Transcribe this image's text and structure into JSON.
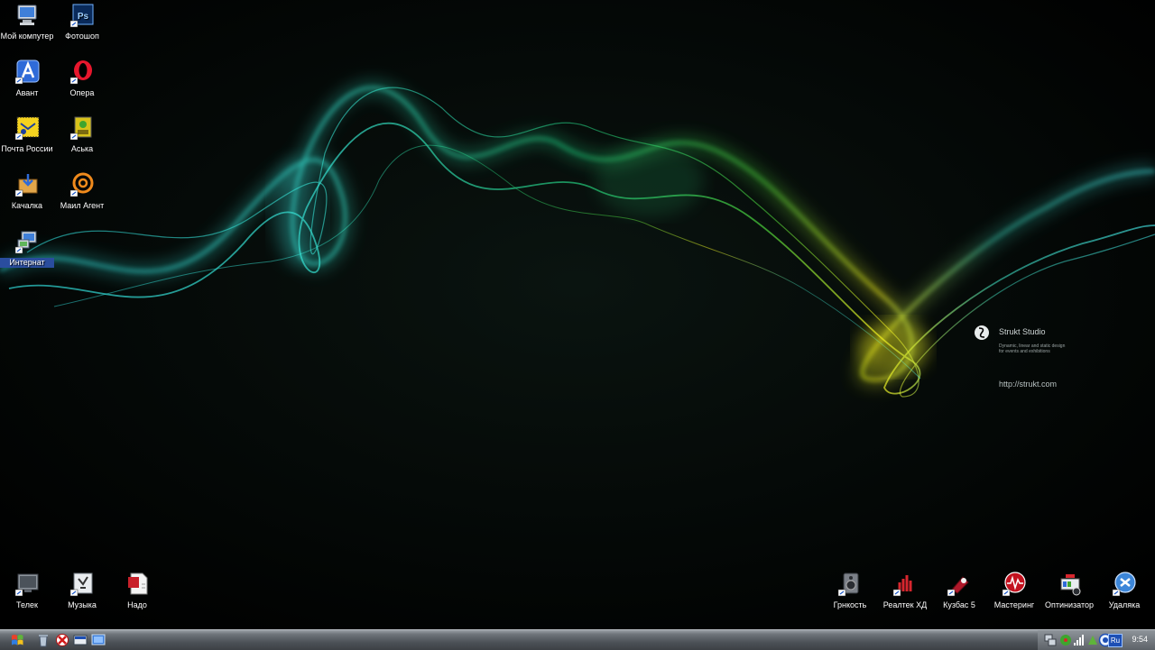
{
  "desktop": {
    "icons_left": [
      {
        "label": "Мой компутер",
        "icon": "my-computer-icon"
      },
      {
        "label": "Фотошоп",
        "icon": "photoshop-icon",
        "badge": "Ps"
      },
      {
        "label": "Авант",
        "icon": "avant-browser-icon"
      },
      {
        "label": "Опера",
        "icon": "opera-icon"
      },
      {
        "label": "Почта России",
        "icon": "mail-russia-icon"
      },
      {
        "label": "Аська",
        "icon": "icq-icon"
      },
      {
        "label": "Качалка",
        "icon": "download-manager-icon"
      },
      {
        "label": "Маил Агент",
        "icon": "mail-agent-icon"
      },
      {
        "label": "Интернат",
        "icon": "internet-connection-icon"
      }
    ],
    "icons_bottom_left": [
      {
        "label": "Телек",
        "icon": "tv-icon"
      },
      {
        "label": "Музыка",
        "icon": "music-icon"
      },
      {
        "label": "Надо",
        "icon": "document-icon"
      }
    ],
    "icons_bottom_right": [
      {
        "label": "Грнкость",
        "icon": "speaker-icon"
      },
      {
        "label": "Реалтек ХД",
        "icon": "realtek-hd-icon"
      },
      {
        "label": "Кузбас 5",
        "icon": "cubase-icon"
      },
      {
        "label": "Мастеринг",
        "icon": "mastering-icon"
      },
      {
        "label": "Оптинизатор",
        "icon": "optimizer-icon"
      },
      {
        "label": "Удаляка",
        "icon": "uninstaller-icon"
      }
    ]
  },
  "wallpaper": {
    "brand_name": "Strukt Studio",
    "brand_tagline_1": "Dynamic, linear and static design",
    "brand_tagline_2": "for events and exhibitions",
    "brand_url": "http://strukt.com"
  },
  "taskbar": {
    "clock": "9:54",
    "language": "Ru"
  }
}
